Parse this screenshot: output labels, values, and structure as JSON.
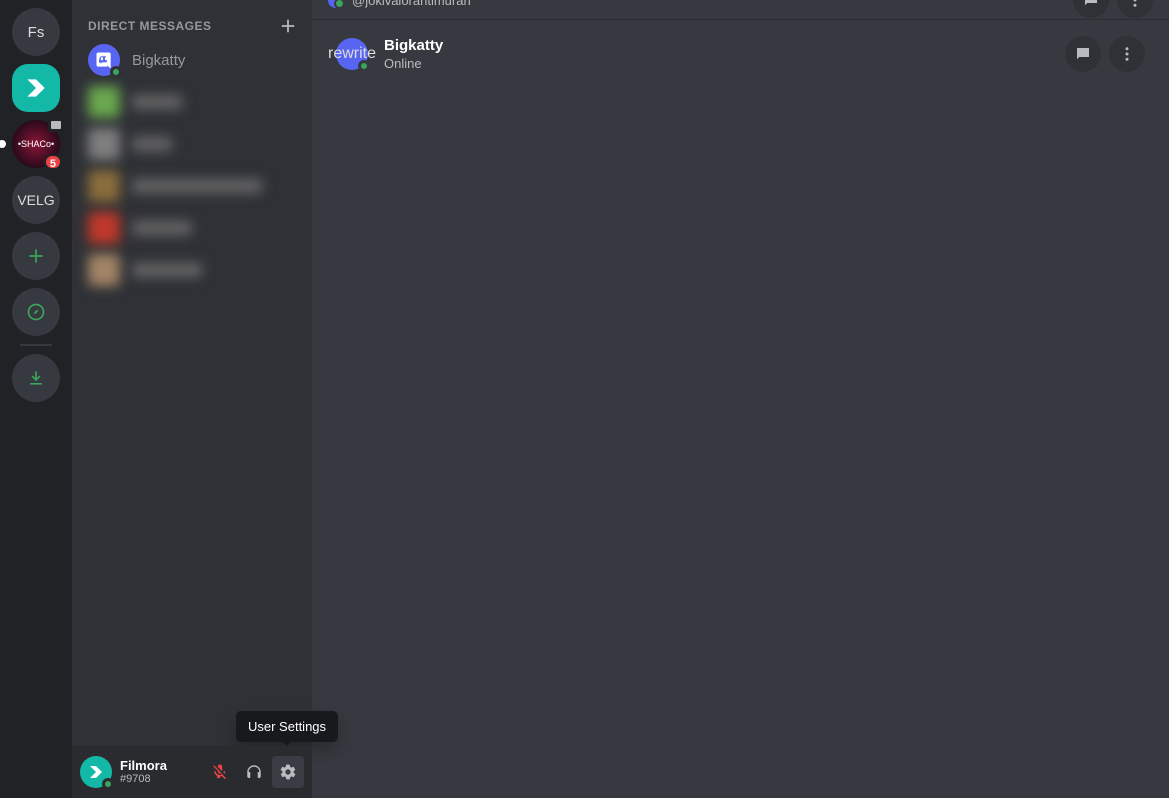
{
  "servers": {
    "fs": "Fs",
    "velg": "VELG",
    "shaco_badge": "5"
  },
  "sidebar": {
    "header": "Direct Messages",
    "dm1_name": "Bigkatty"
  },
  "user": {
    "name": "Filmora",
    "tag": "#9708"
  },
  "tooltip": {
    "settings": "User Settings"
  },
  "main": {
    "truncated_handle": "@jokivalorantimurah",
    "profile_name": "Bigkatty",
    "profile_status": "Online"
  }
}
